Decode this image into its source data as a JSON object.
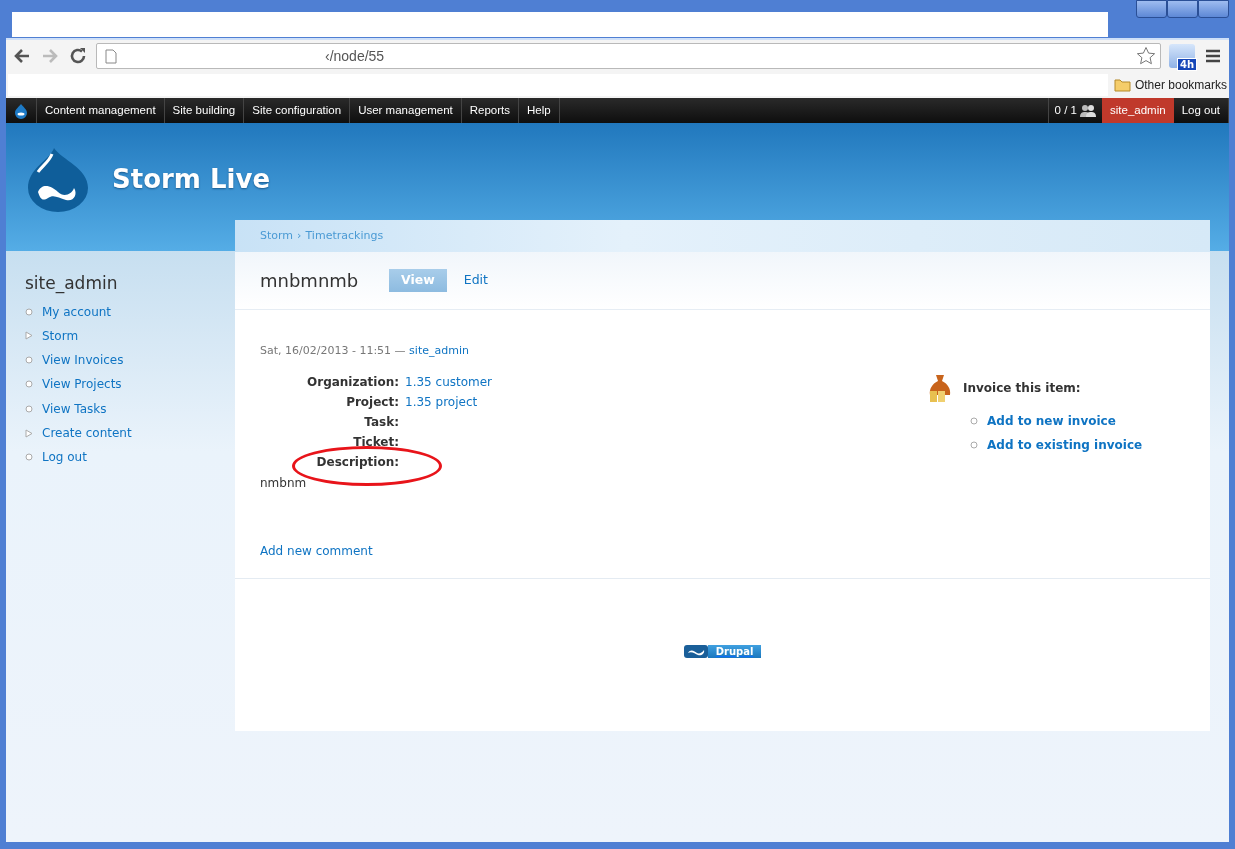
{
  "browser": {
    "address": "‹/node/55",
    "extension_badge": "4h",
    "bookmarks": [
      {
        "label": "Other bookmarks"
      }
    ]
  },
  "admin_menu": {
    "items": [
      "Content management",
      "Site building",
      "Site configuration",
      "User management",
      "Reports",
      "Help"
    ],
    "users_online": "0 / 1",
    "user": "site_admin",
    "logout": "Log out"
  },
  "site": {
    "name": "Storm Live"
  },
  "breadcrumb": {
    "items": [
      "Storm",
      "Timetrackings"
    ],
    "separator": "›"
  },
  "sidebar": {
    "title": "site_admin",
    "items": [
      {
        "label": "My account",
        "kind": "leaf"
      },
      {
        "label": "Storm",
        "kind": "collapsed"
      },
      {
        "label": "View Invoices",
        "kind": "leaf"
      },
      {
        "label": "View Projects",
        "kind": "leaf"
      },
      {
        "label": "View Tasks",
        "kind": "leaf"
      },
      {
        "label": "Create content",
        "kind": "collapsed"
      },
      {
        "label": "Log out",
        "kind": "leaf"
      }
    ]
  },
  "node": {
    "title": "mnbmnmb",
    "tabs": [
      {
        "label": "View",
        "selected": true
      },
      {
        "label": "Edit",
        "selected": false
      }
    ],
    "submitted": {
      "date": "Sat, 16/02/2013 - 11:51 —",
      "author": "site_admin"
    },
    "fields": [
      {
        "label": "Organization:",
        "value": "1.35 customer",
        "circled": false
      },
      {
        "label": "Project:",
        "value": "1.35 project",
        "circled": false
      },
      {
        "label": "Task:",
        "circled": false
      },
      {
        "label": "Ticket:",
        "circled": false
      },
      {
        "label": "Description:",
        "circled": true
      }
    ],
    "body": "nmbnm",
    "links": [
      "Add new comment"
    ]
  },
  "invoice": {
    "title": "Invoice this item:",
    "links": [
      "Add to new invoice",
      "Add to existing invoice"
    ]
  },
  "footer": {
    "badge": "Drupal"
  }
}
